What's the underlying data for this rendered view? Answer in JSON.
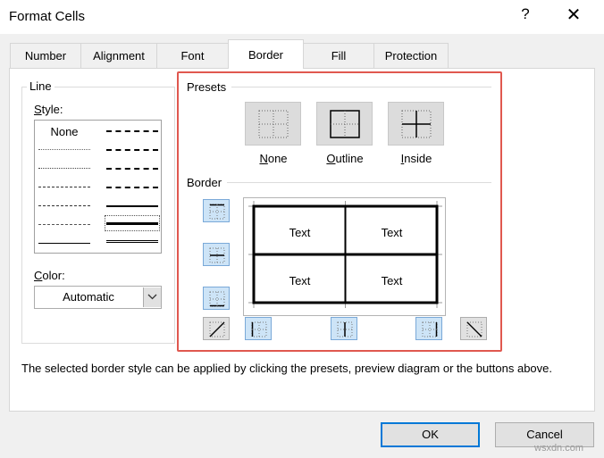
{
  "dialog": {
    "title": "Format Cells",
    "help_label": "?",
    "close_label": "✕"
  },
  "tabs": [
    {
      "label": "Number"
    },
    {
      "label": "Alignment"
    },
    {
      "label": "Font"
    },
    {
      "label": "Border",
      "active": true
    },
    {
      "label": "Fill"
    },
    {
      "label": "Protection"
    }
  ],
  "line": {
    "group_label": "Line",
    "style_label_pre": "",
    "style_label_key": "S",
    "style_label_post": "tyle:",
    "style_none": "None",
    "color_label_pre": "",
    "color_label_key": "C",
    "color_label_post": "olor:",
    "color_value": "Automatic"
  },
  "presets": {
    "group_label": "Presets",
    "items": [
      {
        "key": "N",
        "rest": "one",
        "icon": "preset-none-icon"
      },
      {
        "key": "O",
        "rest": "utline",
        "icon": "preset-outline-icon"
      },
      {
        "key": "I",
        "rest": "nside",
        "icon": "preset-inside-icon"
      }
    ]
  },
  "border": {
    "group_label": "Border",
    "preview_cells": [
      "Text",
      "Text",
      "Text",
      "Text"
    ],
    "buttons": [
      {
        "name": "top-border-icon",
        "state": "on"
      },
      {
        "name": "inside-horizontal-border-icon",
        "state": "on"
      },
      {
        "name": "bottom-border-icon",
        "state": "on"
      },
      {
        "name": "diagonal-up-border-icon",
        "state": "off"
      },
      {
        "name": "left-border-icon",
        "state": "on"
      },
      {
        "name": "inside-vertical-border-icon",
        "state": "on"
      },
      {
        "name": "right-border-icon",
        "state": "on"
      },
      {
        "name": "diagonal-down-border-icon",
        "state": "off"
      }
    ]
  },
  "hint_text": "The selected border style can be applied by clicking the presets, preview diagram or the buttons above.",
  "footer": {
    "ok_label": "OK",
    "cancel_label": "Cancel"
  },
  "watermark": "wsxdn.com",
  "colors": {
    "highlight": "#e0584f",
    "button_on_bg": "#cde4f7",
    "button_on_border": "#7aa9d8",
    "default_button_border": "#0078d7"
  }
}
